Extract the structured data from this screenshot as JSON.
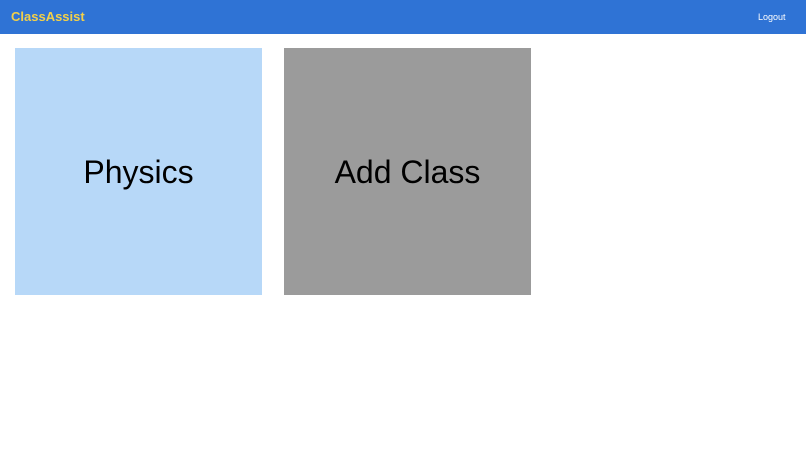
{
  "header": {
    "brand": "ClassAssist",
    "logout_label": "Logout"
  },
  "classes": [
    {
      "label": "Physics"
    }
  ],
  "add_card": {
    "label": "Add Class"
  },
  "colors": {
    "header_bg": "#2f73d5",
    "brand_text": "#f2d04a",
    "class_card_bg": "#b7d8f8",
    "add_card_bg": "#9b9b9b"
  }
}
